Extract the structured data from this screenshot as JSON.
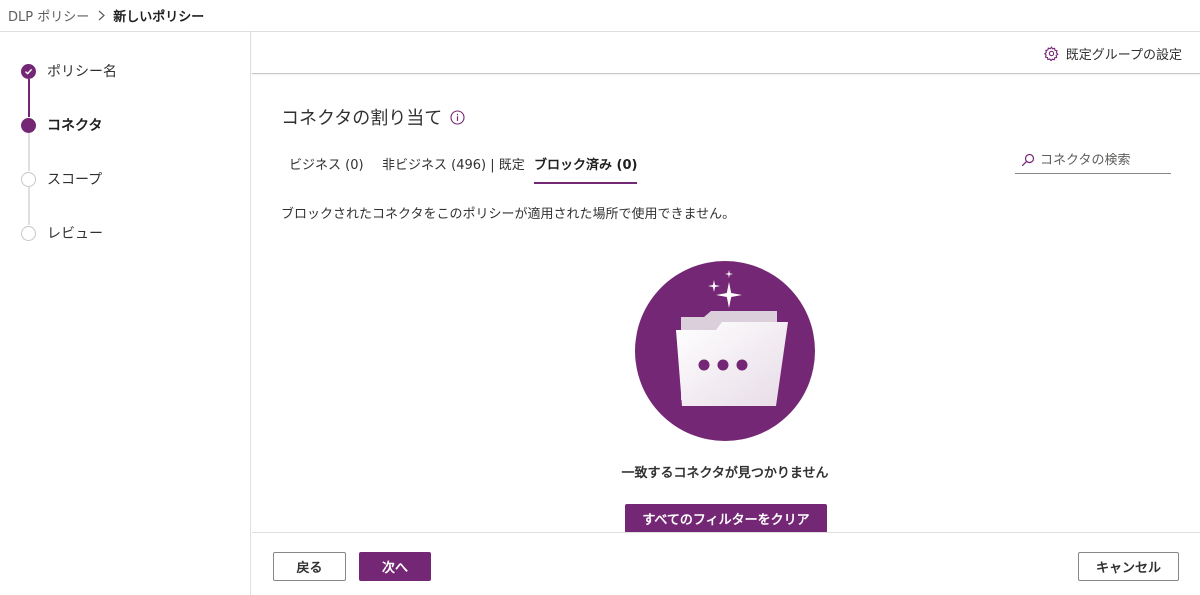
{
  "breadcrumb": {
    "parent": "DLP ポリシー",
    "current": "新しいポリシー"
  },
  "steps": [
    {
      "label": "ポリシー名",
      "state": "done"
    },
    {
      "label": "コネクタ",
      "state": "current"
    },
    {
      "label": "スコープ",
      "state": "pending"
    },
    {
      "label": "レビュー",
      "state": "pending"
    }
  ],
  "command_bar": {
    "default_group_settings": "既定グループの設定"
  },
  "section": {
    "title": "コネクタの割り当て"
  },
  "tabs": [
    {
      "label": "ビジネス (0)"
    },
    {
      "label": "非ビジネス (496) | 既定"
    },
    {
      "label": "ブロック済み (0)"
    }
  ],
  "search": {
    "placeholder": "コネクタの検索"
  },
  "description": "ブロックされたコネクタをこのポリシーが適用された場所で使用できません。",
  "empty_state": {
    "message": "一致するコネクタが見つかりません",
    "clear_button": "すべてのフィルターをクリア"
  },
  "footer": {
    "back": "戻る",
    "next": "次へ",
    "cancel": "キャンセル"
  },
  "colors": {
    "accent": "#742774",
    "border": "#e1dfdd",
    "text": "#323130"
  }
}
